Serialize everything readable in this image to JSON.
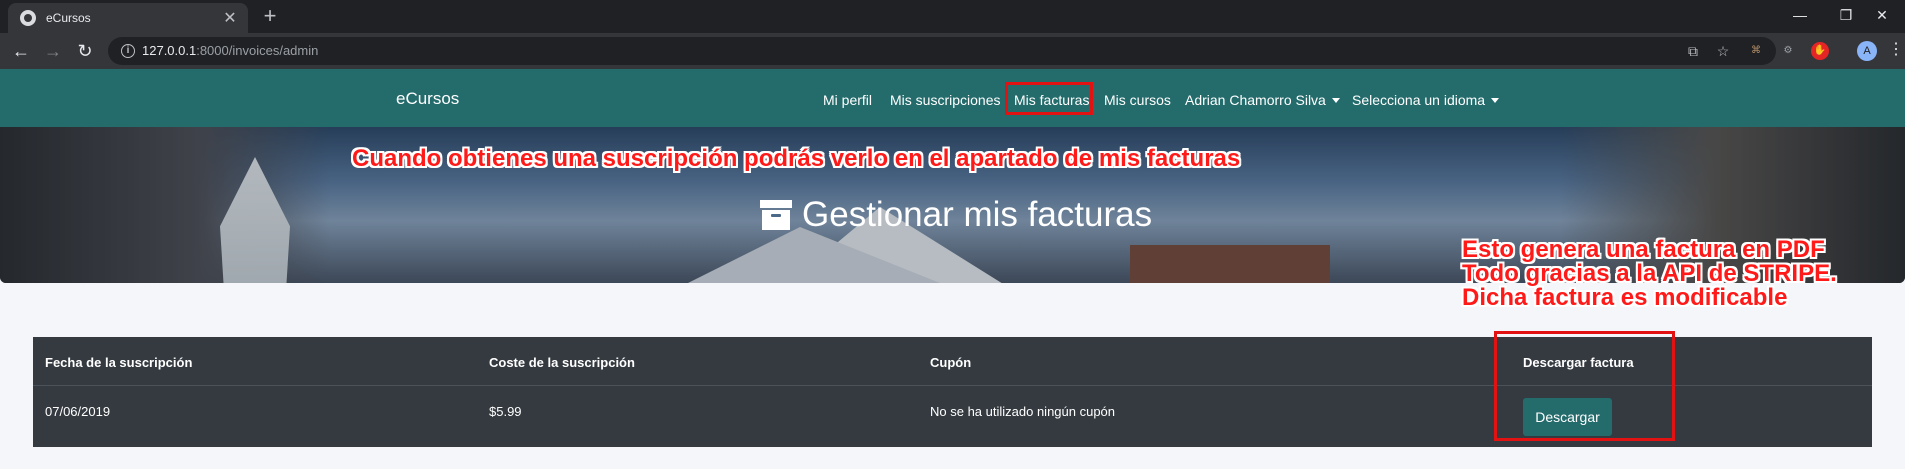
{
  "browser": {
    "tab_title": "eCursos",
    "url_host": "127.0.0.1",
    "url_rest": ":8000/invoices/admin",
    "avatar_letter": "A"
  },
  "navbar": {
    "brand": "eCursos",
    "links": [
      "Mi perfil",
      "Mis suscripciones",
      "Mis facturas",
      "Mis cursos"
    ],
    "user_dropdown": "Adrian Chamorro Silva",
    "language_dropdown": "Selecciona un idioma",
    "accent_color": "#246b6c"
  },
  "hero": {
    "title": "Gestionar mis facturas",
    "icon": "archive-icon"
  },
  "annotations": {
    "top": "Cuando obtienes una suscripción podrás verlo en el apartado de mis facturas",
    "right_lines": [
      "Esto genera una factura en PDF",
      "Todo gracias a la API de STRIPE.",
      "Dicha factura es modificable"
    ],
    "color": "#ff1a1a"
  },
  "table": {
    "headers": [
      "Fecha de la suscripción",
      "Coste de la suscripción",
      "Cupón",
      "Descargar factura"
    ],
    "rows": [
      {
        "date": "07/06/2019",
        "cost": "$5.99",
        "coupon": "No se ha utilizado ningún cupón",
        "action": "Descargar"
      }
    ]
  }
}
